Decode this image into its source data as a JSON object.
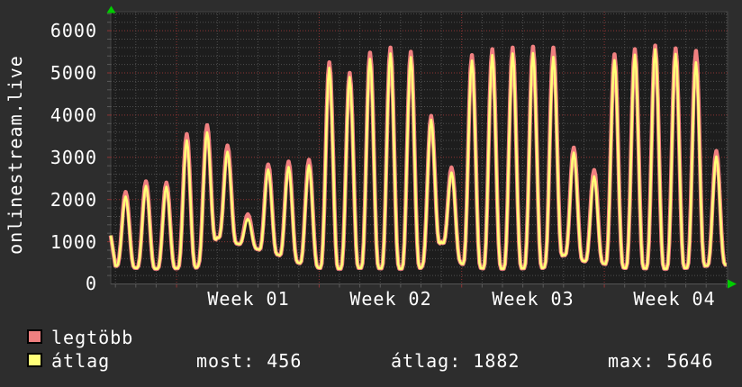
{
  "vertical_title": "onlinestream.live",
  "colors": {
    "page_bg": "#2d2d2d",
    "plot_bg": "#1d1d1d",
    "grid_minor": "#4f4f4f",
    "grid_major": "#8f3434",
    "series_max": "#f08080",
    "series_avg": "#ffff78",
    "arrow_green": "#00cc00",
    "text": "#ffffff",
    "plot_border": "#424242"
  },
  "chart_data": {
    "type": "line",
    "title": "onlinestream.live",
    "xlabel": "",
    "ylabel": "onlinestream.live",
    "x_axis": {
      "tick_labels": [
        "Week 01",
        "Week 02",
        "Week 03",
        "Week 04"
      ],
      "days_shown": 30,
      "week_boundary_day_indices": [
        3,
        10,
        17,
        24
      ]
    },
    "y_axis": {
      "min": 0,
      "max_visible": 6450,
      "major_step": 1000,
      "minor_step": 200,
      "tick_labels": [
        "0",
        "1000",
        "2000",
        "3000",
        "4000",
        "5000",
        "6000"
      ]
    },
    "grid": true,
    "legend_position": "bottom-left",
    "series": [
      {
        "name": "legtöbb",
        "color": "#f08080",
        "daily_peaks": [
          2180,
          2430,
          2400,
          3550,
          3760,
          3280,
          1650,
          2830,
          2900,
          2940,
          5250,
          5000,
          5480,
          5600,
          5500,
          3980,
          2760,
          5420,
          5560,
          5600,
          5620,
          5600,
          3230,
          2700,
          5440,
          5560,
          5646,
          5580,
          5520,
          3150
        ]
      },
      {
        "name": "átlag",
        "color": "#ffff78",
        "daily_peaks": [
          2070,
          2320,
          2300,
          3400,
          3590,
          3130,
          1540,
          2710,
          2770,
          2810,
          5120,
          4900,
          5330,
          5460,
          5370,
          3890,
          2640,
          5290,
          5420,
          5460,
          5470,
          5380,
          3110,
          2550,
          5300,
          5430,
          5560,
          5450,
          5250,
          3020
        ]
      }
    ],
    "daily_troughs": [
      430,
      380,
      360,
      370,
      390,
      1100,
      950,
      820,
      690,
      500,
      380,
      360,
      380,
      370,
      360,
      380,
      1000,
      480,
      370,
      360,
      370,
      380,
      690,
      540,
      480,
      380,
      370,
      360,
      380,
      430,
      456
    ],
    "start_value": 1150,
    "end_value": 456
  },
  "legend": {
    "items": [
      {
        "label": "legtöbb",
        "color": "#f08080"
      },
      {
        "label": "átlag",
        "color": "#ffff78"
      }
    ]
  },
  "stats": {
    "most": {
      "label": "most",
      "value": "456",
      "display": "most: 456"
    },
    "atlag": {
      "label": "átlag",
      "value": "1882",
      "display": "átlag: 1882"
    },
    "max": {
      "label": "max",
      "value": "5646",
      "display": "max: 5646"
    }
  }
}
